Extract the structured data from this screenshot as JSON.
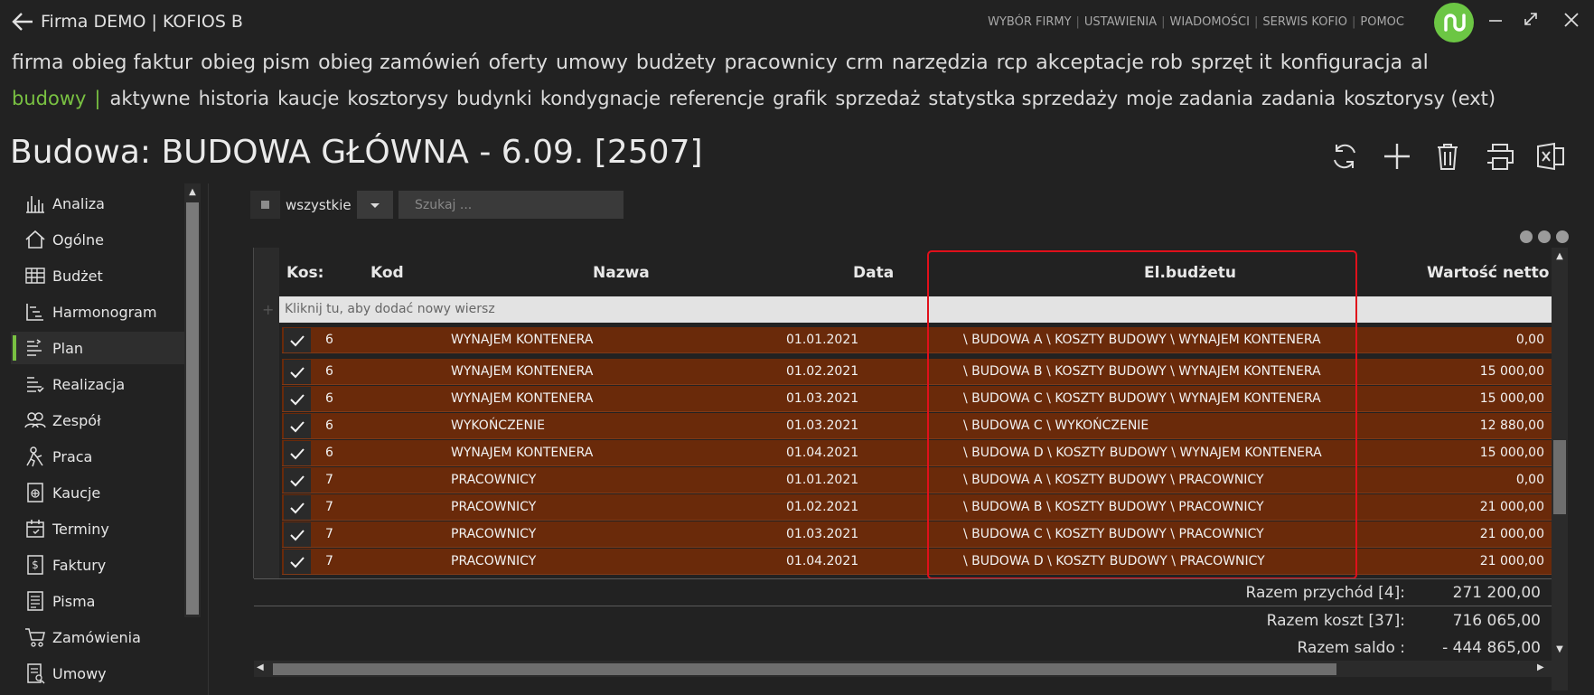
{
  "header": {
    "title": "Firma DEMO | KOFIOS B",
    "links": [
      "WYBÓR FIRMY",
      "USTAWIENIA",
      "WIADOMOŚCI",
      "SERWIS KOFIO",
      "POMOC"
    ]
  },
  "nav_primary": [
    "firma",
    "obieg faktur",
    "obieg pism",
    "obieg zamówień",
    "oferty",
    "umowy",
    "budżety",
    "pracownicy",
    "crm",
    "narzędzia",
    "rcp",
    "akceptacje rob",
    "sprzęt it",
    "konfiguracja",
    "al"
  ],
  "nav_secondary": {
    "active": "budowy",
    "separator": "|",
    "items": [
      "aktywne",
      "historia",
      "kaucje",
      "kosztorysy",
      "budynki",
      "kondygnacje",
      "referencje",
      "grafik",
      "sprzedaż",
      "statystka sprzedaży",
      "moje zadania",
      "zadania",
      "kosztorysy (ext)"
    ]
  },
  "page": {
    "title": "Budowa: BUDOWA GŁÓWNA - 6.09. [2507]"
  },
  "toolbar": [
    "refresh-icon",
    "plus-icon",
    "trash-icon",
    "print-icon",
    "excel-icon"
  ],
  "sidebar": {
    "items": [
      {
        "label": "Analiza",
        "icon": "chart-icon",
        "active": false
      },
      {
        "label": "Ogólne",
        "icon": "home-icon",
        "active": false
      },
      {
        "label": "Budżet",
        "icon": "table-icon",
        "active": false
      },
      {
        "label": "Harmonogram",
        "icon": "gantt-icon",
        "active": false
      },
      {
        "label": "Plan",
        "icon": "plan-icon",
        "active": true
      },
      {
        "label": "Realizacja",
        "icon": "realization-icon",
        "active": false
      },
      {
        "label": "Zespół",
        "icon": "team-icon",
        "active": false
      },
      {
        "label": "Praca",
        "icon": "worker-icon",
        "active": false
      },
      {
        "label": "Kaucje",
        "icon": "deposit-icon",
        "active": false
      },
      {
        "label": "Terminy",
        "icon": "calendar-icon",
        "active": false
      },
      {
        "label": "Faktury",
        "icon": "invoice-icon",
        "active": false
      },
      {
        "label": "Pisma",
        "icon": "letter-icon",
        "active": false
      },
      {
        "label": "Zamówienia",
        "icon": "cart-icon",
        "active": false
      },
      {
        "label": "Umowy",
        "icon": "contract-icon",
        "active": false
      }
    ]
  },
  "filter": {
    "all_label": "wszystkie",
    "search_placeholder": "Szukaj ..."
  },
  "grid": {
    "columns": {
      "kos": "Kos:",
      "kod": "Kod",
      "nazwa": "Nazwa",
      "data": "Data",
      "el": "El.budżetu",
      "wartosc": "Wartość netto"
    },
    "new_row_text": "Kliknij tu, aby dodać nowy wiersz",
    "rows": [
      {
        "kod": "6",
        "nazwa": "WYNAJEM KONTENERA",
        "data": "01.01.2021",
        "el": "\\ BUDOWA A \\ KOSZTY BUDOWY \\ WYNAJEM KONTENERA",
        "wartosc": "0,00"
      },
      {
        "kod": "6",
        "nazwa": "WYNAJEM KONTENERA",
        "data": "01.02.2021",
        "el": "\\ BUDOWA B \\ KOSZTY BUDOWY \\ WYNAJEM KONTENERA",
        "wartosc": "15 000,00"
      },
      {
        "kod": "6",
        "nazwa": "WYNAJEM KONTENERA",
        "data": "01.03.2021",
        "el": "\\ BUDOWA C \\ KOSZTY BUDOWY \\ WYNAJEM KONTENERA",
        "wartosc": "15 000,00"
      },
      {
        "kod": "6",
        "nazwa": "WYKOŃCZENIE",
        "data": "01.03.2021",
        "el": "\\ BUDOWA C \\ WYKOŃCZENIE",
        "wartosc": "12 880,00"
      },
      {
        "kod": "6",
        "nazwa": "WYNAJEM KONTENERA",
        "data": "01.04.2021",
        "el": "\\ BUDOWA D \\ KOSZTY BUDOWY \\ WYNAJEM KONTENERA",
        "wartosc": "15 000,00"
      },
      {
        "kod": "7",
        "nazwa": "PRACOWNICY",
        "data": "01.01.2021",
        "el": "\\ BUDOWA A \\ KOSZTY BUDOWY \\ PRACOWNICY",
        "wartosc": "0,00"
      },
      {
        "kod": "7",
        "nazwa": "PRACOWNICY",
        "data": "01.02.2021",
        "el": "\\ BUDOWA B \\ KOSZTY BUDOWY \\ PRACOWNICY",
        "wartosc": "21 000,00"
      },
      {
        "kod": "7",
        "nazwa": "PRACOWNICY",
        "data": "01.03.2021",
        "el": "\\ BUDOWA C \\ KOSZTY BUDOWY \\ PRACOWNICY",
        "wartosc": "21 000,00"
      },
      {
        "kod": "7",
        "nazwa": "PRACOWNICY",
        "data": "01.04.2021",
        "el": "\\ BUDOWA D \\ KOSZTY BUDOWY \\ PRACOWNICY",
        "wartosc": "21 000,00"
      }
    ]
  },
  "totals": [
    {
      "label": "Razem przychód [4]:",
      "value": "271 200,00"
    },
    {
      "label": "Razem koszt [37]:",
      "value": "716 065,00"
    },
    {
      "label": "Razem saldo :",
      "value": "- 444 865,00"
    }
  ],
  "colors": {
    "accent": "#79c142",
    "row_bg": "#6a2a0a",
    "highlight": "#e0101b"
  }
}
